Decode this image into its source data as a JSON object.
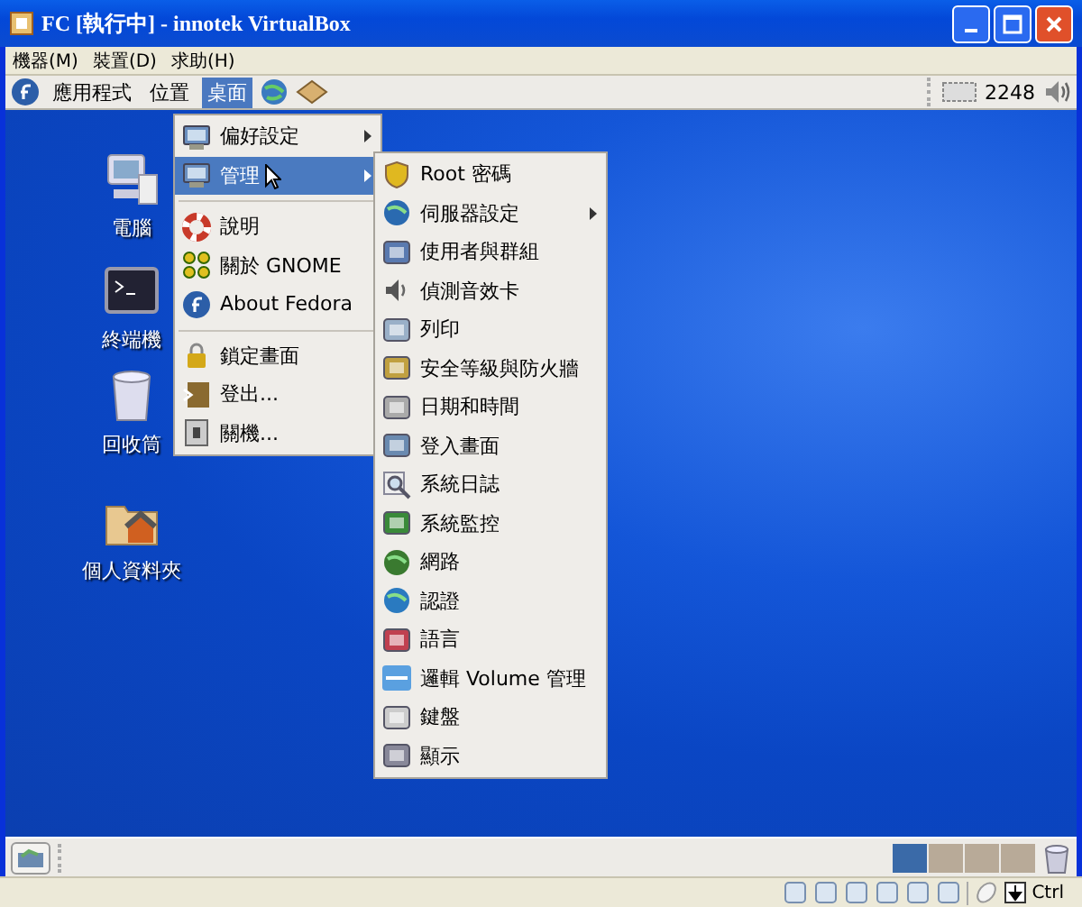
{
  "window": {
    "title": "FC [執行中] - innotek VirtualBox"
  },
  "menubar": [
    "機器(M)",
    "裝置(D)",
    "求助(H)"
  ],
  "panel": {
    "menus": [
      {
        "label": "應用程式",
        "selected": false
      },
      {
        "label": "位置",
        "selected": false
      },
      {
        "label": "桌面",
        "selected": true
      }
    ],
    "clock": "2248"
  },
  "desktop_icons": [
    {
      "label": "電腦"
    },
    {
      "label": "終端機"
    },
    {
      "label": "回收筒"
    },
    {
      "label": "個人資料夾"
    }
  ],
  "menu": {
    "items": [
      {
        "kind": "item",
        "label": "偏好設定",
        "submenu": true,
        "selected": false
      },
      {
        "kind": "item",
        "label": "管理",
        "submenu": true,
        "selected": true
      },
      {
        "kind": "separator"
      },
      {
        "kind": "item",
        "label": "說明",
        "submenu": false,
        "selected": false
      },
      {
        "kind": "item",
        "label": "關於 GNOME",
        "submenu": false,
        "selected": false
      },
      {
        "kind": "item",
        "label": "About Fedora",
        "submenu": false,
        "selected": false
      },
      {
        "kind": "separator"
      },
      {
        "kind": "item",
        "label": "鎖定畫面",
        "submenu": false,
        "selected": false
      },
      {
        "kind": "item",
        "label": "登出...",
        "submenu": false,
        "selected": false
      },
      {
        "kind": "item",
        "label": "關機...",
        "submenu": false,
        "selected": false
      }
    ]
  },
  "submenu": {
    "items": [
      {
        "label": "Root 密碼",
        "submenu": false
      },
      {
        "label": "伺服器設定",
        "submenu": true
      },
      {
        "label": "使用者與群組",
        "submenu": false
      },
      {
        "label": "偵測音效卡",
        "submenu": false
      },
      {
        "label": "列印",
        "submenu": false
      },
      {
        "label": "安全等級與防火牆",
        "submenu": false
      },
      {
        "label": "日期和時間",
        "submenu": false
      },
      {
        "label": "登入畫面",
        "submenu": false
      },
      {
        "label": "系統日誌",
        "submenu": false
      },
      {
        "label": "系統監控",
        "submenu": false
      },
      {
        "label": "網路",
        "submenu": false
      },
      {
        "label": "認證",
        "submenu": false
      },
      {
        "label": "語言",
        "submenu": false
      },
      {
        "label": "邏輯 Volume 管理",
        "submenu": false
      },
      {
        "label": "鍵盤",
        "submenu": false
      },
      {
        "label": "顯示",
        "submenu": false
      }
    ]
  },
  "workspaces": [
    {
      "selected": true
    },
    {
      "selected": false
    },
    {
      "selected": false
    },
    {
      "selected": false
    }
  ],
  "status_bar": {
    "host_key": "Ctrl"
  }
}
